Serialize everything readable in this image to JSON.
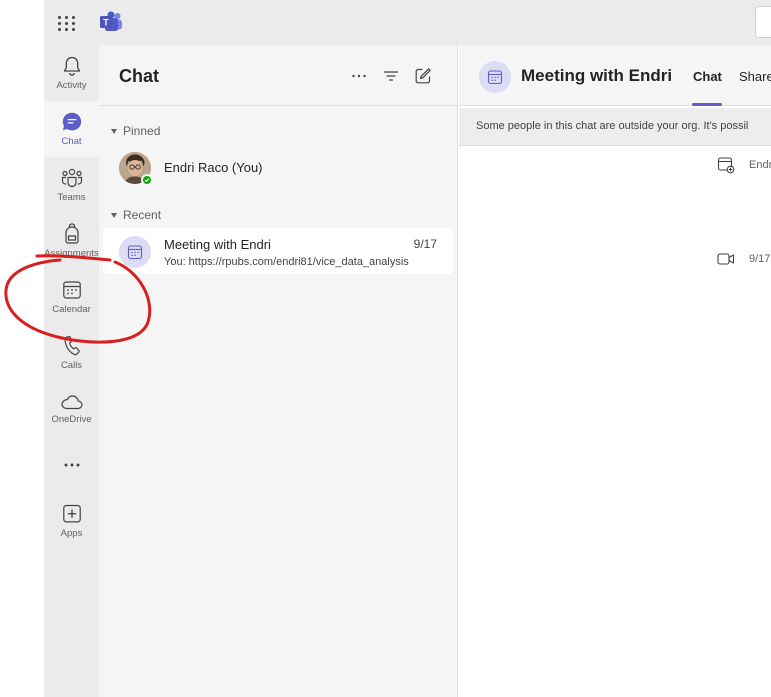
{
  "topbar": {
    "app_name": "Microsoft Teams"
  },
  "rail": {
    "items": [
      {
        "label": "Activity",
        "icon": "bell-icon"
      },
      {
        "label": "Chat",
        "icon": "chat-icon"
      },
      {
        "label": "Teams",
        "icon": "teams-icon"
      },
      {
        "label": "Assignments",
        "icon": "backpack-icon"
      },
      {
        "label": "Calendar",
        "icon": "calendar-icon"
      },
      {
        "label": "Calls",
        "icon": "phone-icon"
      },
      {
        "label": "OneDrive",
        "icon": "cloud-icon"
      },
      {
        "label": "Apps",
        "icon": "apps-add-icon"
      }
    ],
    "more_icon": "more-horizontal-icon"
  },
  "chatlist": {
    "title": "Chat",
    "pinned_label": "Pinned",
    "recent_label": "Recent",
    "pinned": [
      {
        "name": "Endri Raco (You)",
        "presence": "available"
      }
    ],
    "recent": [
      {
        "name": "Meeting with Endri",
        "date": "9/17",
        "preview": "You: https://rpubs.com/endri81/vice_data_analysis"
      }
    ]
  },
  "main": {
    "title": "Meeting with Endri",
    "tabs": [
      {
        "label": "Chat",
        "active": true
      },
      {
        "label": "Share",
        "active": false
      }
    ],
    "banner": "Some people in this chat are outside your org. It's possil",
    "events": [
      {
        "icon": "calendar-add-icon",
        "text": "Endr"
      },
      {
        "icon": "video-icon",
        "text": "9/17"
      }
    ]
  },
  "colors": {
    "accent": "#5b5fc7",
    "annotation": "#d6201e",
    "presence_available": "#13a10e"
  }
}
